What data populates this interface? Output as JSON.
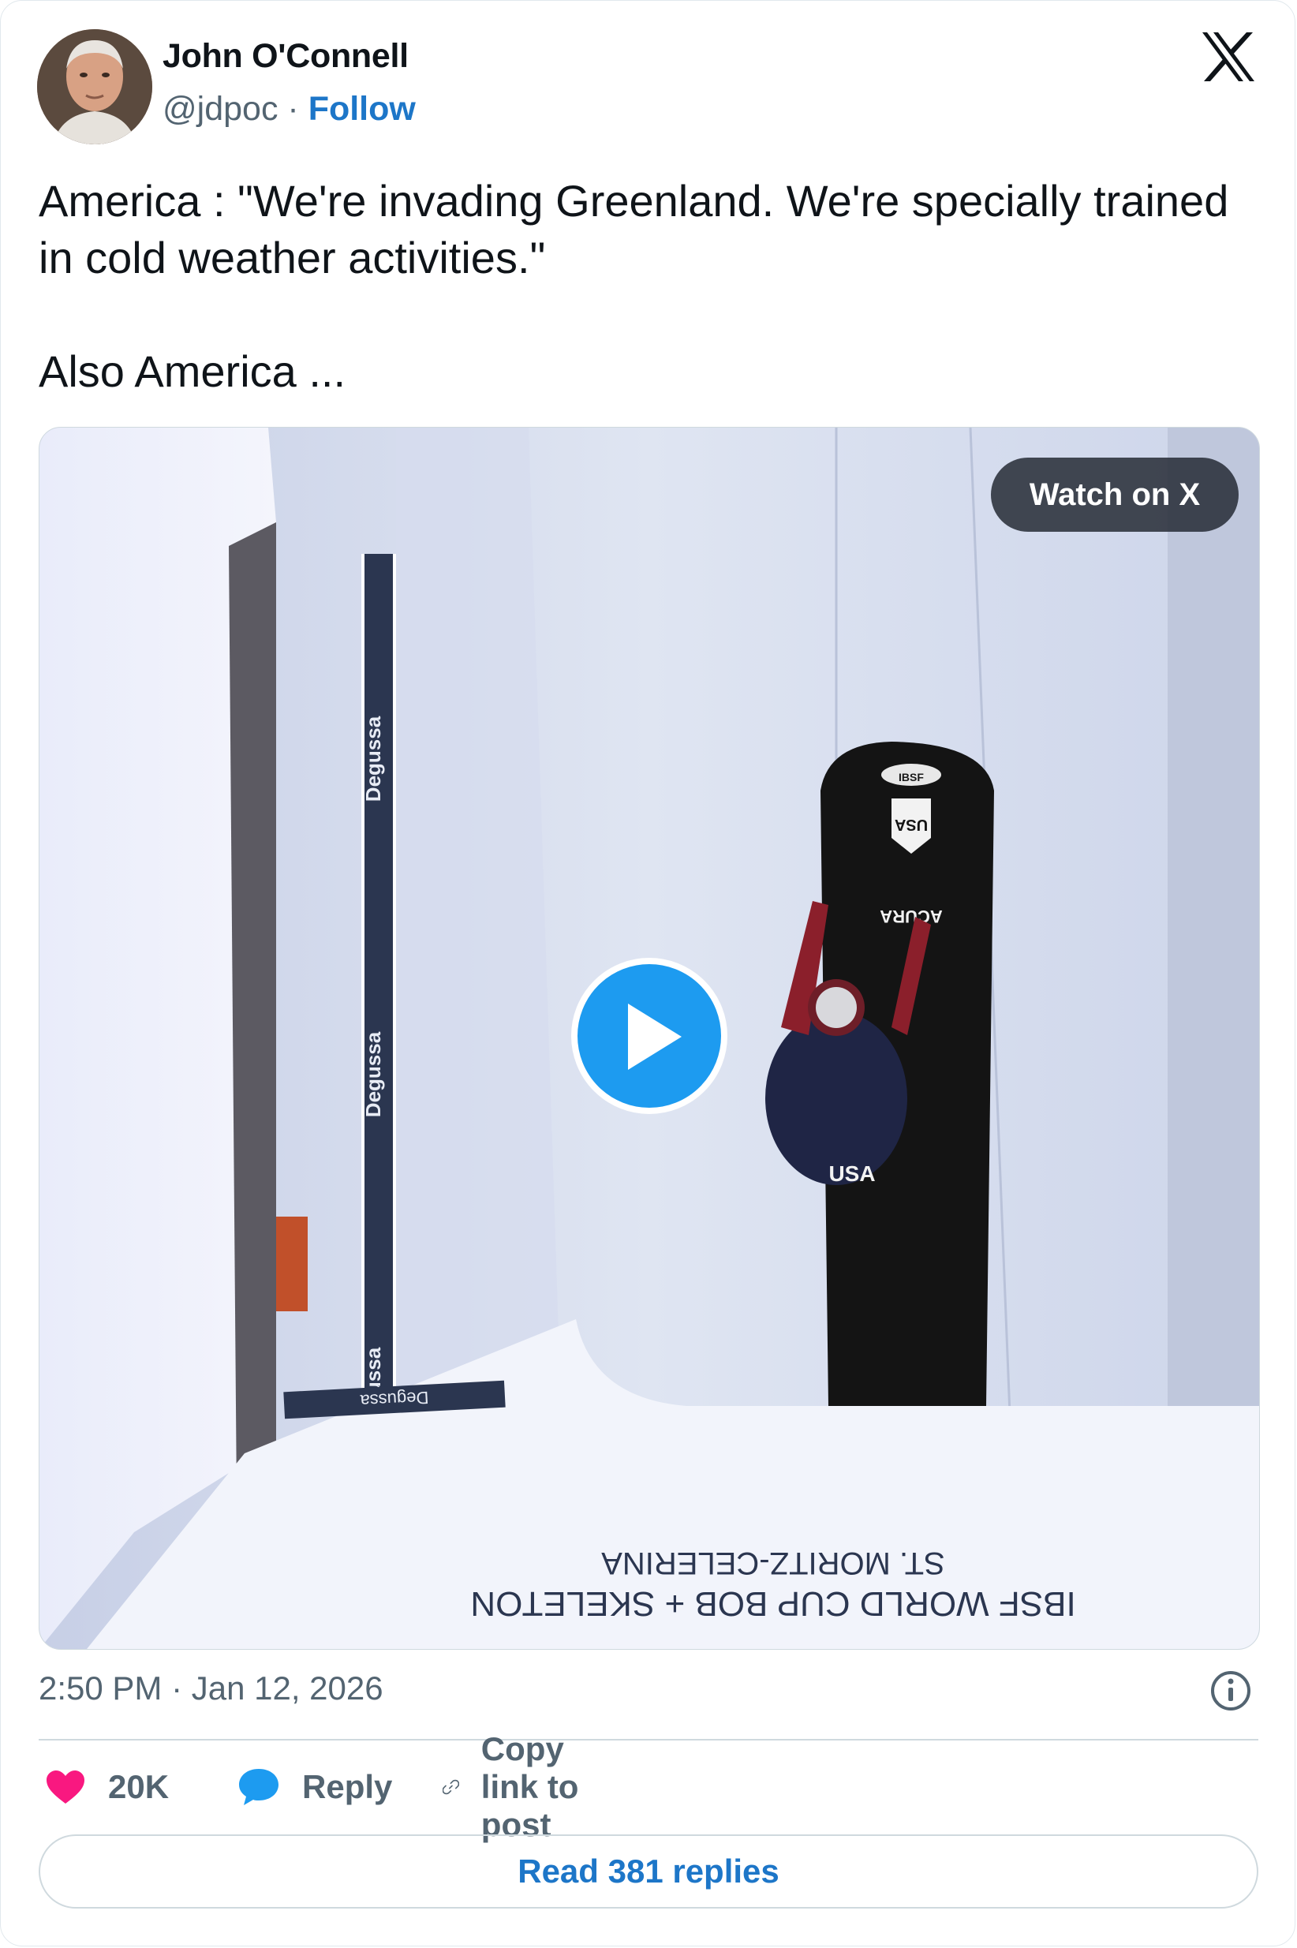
{
  "author": {
    "name": "John O'Connell",
    "handle": "@jdpoc",
    "separator": "·",
    "follow_label": "Follow"
  },
  "brand_icon": "x-logo-icon",
  "tweet": {
    "text": "America : \"We're invading Greenland. We're specially trained in cold weather activities.\"\n\nAlso America ..."
  },
  "media": {
    "watch_label": "Watch on X",
    "play_icon": "play-icon",
    "scene": {
      "banner_text": "Degussa",
      "sled_texts": [
        "IBSF",
        "USA",
        "ACURA"
      ],
      "athlete_text": "USA",
      "floor_line1": "IBSF  WORLD CUP BOB + SKELETON",
      "floor_line2": "ST. MORITZ-CELERINA"
    }
  },
  "timestamp": "2:50 PM · Jan 12, 2026",
  "actions": {
    "like_count": "20K",
    "reply_label": "Reply",
    "copy_label": "Copy link to post"
  },
  "read_replies_label": "Read 381 replies",
  "colors": {
    "accent": "#1d9bf0",
    "link": "#1d76c8",
    "like": "#f91880",
    "muted": "#536471"
  }
}
